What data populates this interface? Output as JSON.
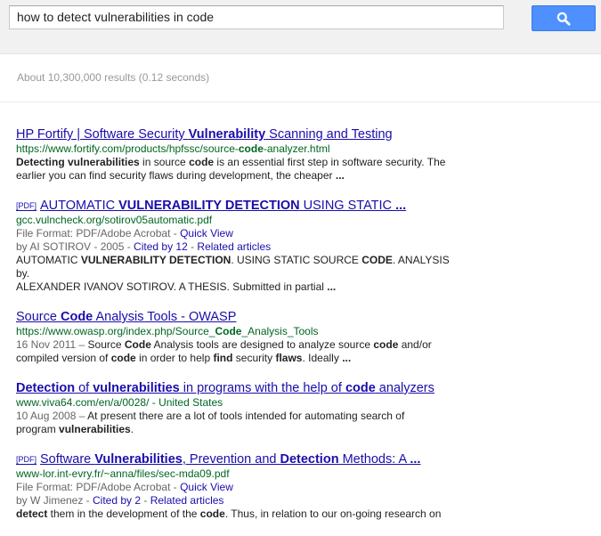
{
  "search": {
    "query": "how to detect vulnerabilities in code",
    "button_icon": "magnifier-icon"
  },
  "stats": "About 10,300,000 results (0.12 seconds)",
  "results": [
    {
      "tag": "",
      "title": [
        [
          "HP Fortify | Software Security ",
          false
        ],
        [
          "Vulnerability",
          true
        ],
        [
          " Scanning and Testing",
          false
        ]
      ],
      "url": [
        [
          "https://www.fortify.com/products/hpfssc/source-",
          false
        ],
        [
          "code",
          true
        ],
        [
          "-analyzer.html",
          false
        ]
      ],
      "meta": [],
      "snippet": [
        [
          [
            "Detecting vulnerabilities",
            true
          ],
          [
            " in source ",
            false
          ],
          [
            "code",
            true
          ],
          [
            " is an essential first step in software security. The",
            false
          ]
        ],
        [
          [
            "earlier you can find security flaws during development, the cheaper ",
            false
          ],
          [
            "...",
            true
          ]
        ]
      ]
    },
    {
      "tag": "[PDF]",
      "title": [
        [
          "AUTOMATIC ",
          false
        ],
        [
          "VULNERABILITY DETECTION",
          true
        ],
        [
          " USING STATIC ",
          false
        ],
        [
          "...",
          true
        ]
      ],
      "url": [
        [
          "gcc.vulncheck.org/sotirov05automatic.pdf",
          false
        ]
      ],
      "meta": [
        [
          [
            "File Format: PDF/Adobe Acrobat - ",
            "t"
          ],
          [
            "Quick View",
            "l"
          ]
        ],
        [
          [
            "by AI SOTIROV - 2005 - ",
            "t"
          ],
          [
            "Cited by 12",
            "l"
          ],
          [
            " - ",
            "t"
          ],
          [
            "Related articles",
            "l"
          ]
        ]
      ],
      "snippet": [
        [
          [
            "AUTOMATIC ",
            false
          ],
          [
            "VULNERABILITY DETECTION",
            true
          ],
          [
            ". USING STATIC SOURCE ",
            false
          ],
          [
            "CODE",
            true
          ],
          [
            ". ANALYSIS by.",
            false
          ]
        ],
        [
          [
            "ALEXANDER IVANOV SOTIROV. A THESIS. Submitted in partial ",
            false
          ],
          [
            "...",
            true
          ]
        ]
      ]
    },
    {
      "tag": "",
      "title": [
        [
          "Source ",
          false
        ],
        [
          "Code",
          true
        ],
        [
          " Analysis Tools - OWASP",
          false
        ]
      ],
      "url": [
        [
          "https://www.owasp.org/index.php/Source_",
          false
        ],
        [
          "Code",
          true
        ],
        [
          "_Analysis_Tools",
          false
        ]
      ],
      "meta": [],
      "snippet": [
        [
          [
            "16 Nov 2011 – ",
            "d"
          ],
          [
            "Source ",
            false
          ],
          [
            "Code",
            true
          ],
          [
            " Analysis tools are designed to analyze source ",
            false
          ],
          [
            "code",
            true
          ],
          [
            " and/or",
            false
          ]
        ],
        [
          [
            "compiled version of ",
            false
          ],
          [
            "code",
            true
          ],
          [
            " in order to help ",
            false
          ],
          [
            "find",
            true
          ],
          [
            " security ",
            false
          ],
          [
            "flaws",
            true
          ],
          [
            ". Ideally ",
            false
          ],
          [
            "...",
            true
          ]
        ]
      ]
    },
    {
      "tag": "",
      "title": [
        [
          "Detection",
          true
        ],
        [
          " of ",
          false
        ],
        [
          "vulnerabilities",
          true
        ],
        [
          " in programs with the help of ",
          false
        ],
        [
          "code",
          true
        ],
        [
          " analyzers",
          false
        ]
      ],
      "url": [
        [
          "www.viva64.com/en/a/0028/",
          false
        ],
        [
          " - United States",
          false
        ]
      ],
      "meta": [],
      "snippet": [
        [
          [
            "10 Aug 2008 – ",
            "d"
          ],
          [
            "At present there are a lot of tools intended for automating search of",
            false
          ]
        ],
        [
          [
            "program ",
            false
          ],
          [
            "vulnerabilities",
            true
          ],
          [
            ".",
            false
          ]
        ]
      ]
    },
    {
      "tag": "[PDF]",
      "title": [
        [
          "Software ",
          false
        ],
        [
          "Vulnerabilities",
          true
        ],
        [
          ", Prevention and ",
          false
        ],
        [
          "Detection",
          true
        ],
        [
          " Methods: A ",
          false
        ],
        [
          "...",
          true
        ]
      ],
      "url": [
        [
          "www-lor.int-evry.fr/~anna/files/sec-mda09.pdf",
          false
        ]
      ],
      "meta": [
        [
          [
            "File Format: PDF/Adobe Acrobat - ",
            "t"
          ],
          [
            "Quick View",
            "l"
          ]
        ],
        [
          [
            "by W Jimenez - ",
            "t"
          ],
          [
            "Cited by 2",
            "l"
          ],
          [
            " - ",
            "t"
          ],
          [
            "Related articles",
            "l"
          ]
        ]
      ],
      "snippet": [
        [
          [
            "detect",
            true
          ],
          [
            " them in the development of the ",
            false
          ],
          [
            "code",
            true
          ],
          [
            ". Thus, in relation to our on-going research on",
            false
          ]
        ]
      ]
    }
  ]
}
